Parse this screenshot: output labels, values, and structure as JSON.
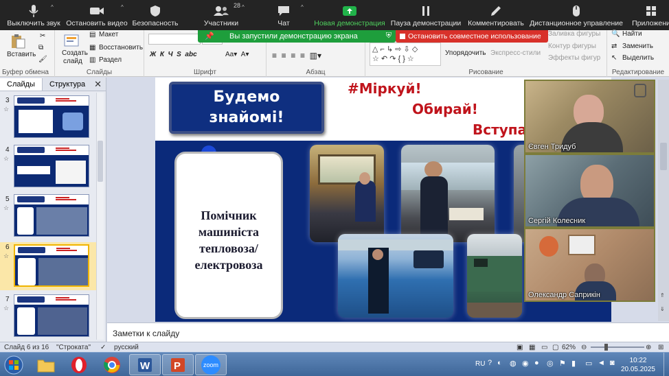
{
  "zoom_toolbar": {
    "mute": "Выключить звук",
    "stop_video": "Остановить видео",
    "security": "Безопасность",
    "participants": "Участники",
    "participants_count": "28",
    "chat": "Чат",
    "new_share": "Новая демонстрация",
    "pause_share": "Пауза демонстрации",
    "annotate": "Комментировать",
    "remote_control": "Дистанционное управление",
    "apps": "Приложени"
  },
  "share_banner": {
    "message": "Вы запустили демонстрацию экрана",
    "stop": "Остановить совместное использование"
  },
  "ribbon": {
    "clipboard": {
      "paste": "Вставить",
      "label": "Буфер обмена"
    },
    "slides": {
      "create": "Создать",
      "create2": "слайд",
      "layout": "Макет",
      "reset": "Восстановить",
      "section": "Раздел",
      "label": "Слайды"
    },
    "font": {
      "label": "Шрифт"
    },
    "paragraph": {
      "label": "Абзац"
    },
    "drawing": {
      "arrange": "Упорядочить",
      "quick_styles": "Экспресс-стили",
      "fill": "Заливка фигуры",
      "outline": "Контур фигуры",
      "effects": "Эффекты фигур",
      "label": "Рисование"
    },
    "editing": {
      "find": "Найти",
      "replace": "Заменить",
      "select": "Выделить",
      "label": "Редактирование"
    }
  },
  "slides_panel": {
    "tab_slides": "Слайды",
    "tab_outline": "Структура",
    "thumbnails": [
      {
        "number": "3"
      },
      {
        "number": "4"
      },
      {
        "number": "5"
      },
      {
        "number": "6",
        "selected": true
      },
      {
        "number": "7"
      }
    ]
  },
  "slide": {
    "title_line1": "Будемо",
    "title_line2": "знайомі!",
    "slogan1": "#Міркуй!",
    "slogan2": "Обирай!",
    "slogan3": "Вступа",
    "card_line1": "Помічник",
    "card_line2": "машиніста",
    "card_line3": "тепловоза/",
    "card_line4": "електровоза"
  },
  "video_tiles": [
    {
      "name": "Євген Тридуб"
    },
    {
      "name": "Сергій Колесник"
    },
    {
      "name": "Олександр Саприкін"
    }
  ],
  "notes": {
    "placeholder": "Заметки к слайду"
  },
  "status_bar": {
    "slide_info": "Слайд 6 из 16",
    "theme": "\"Строката\"",
    "language": "русский",
    "zoom": "62%"
  },
  "taskbar": {
    "lang": "RU",
    "time": "10:22",
    "date": "20.05.2025",
    "zoom_app_label": "zoom"
  },
  "colors": {
    "zoom_green": "#4fd25e",
    "share_red": "#d8312a",
    "slide_blue": "#0b2a7a",
    "slogan_red": "#c0141c"
  }
}
